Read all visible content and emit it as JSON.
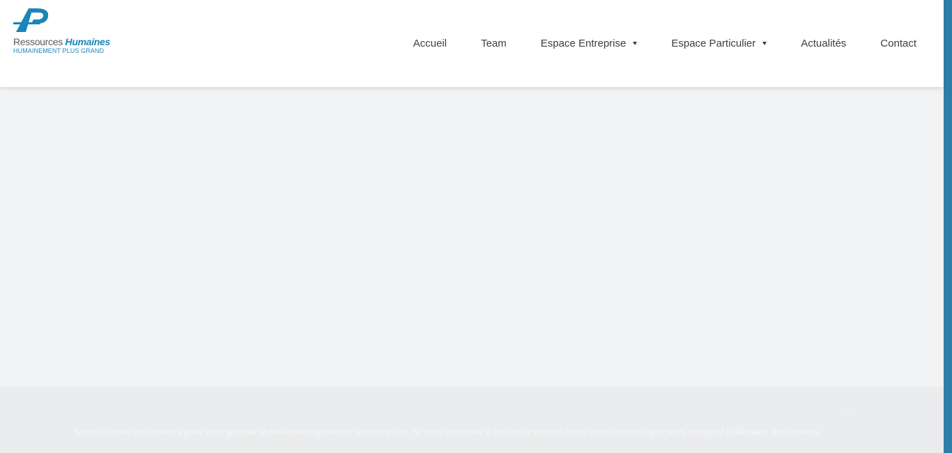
{
  "logo": {
    "brand": "Ressources",
    "brand_accent": "Humaines",
    "tagline": "HUMAINEMENT PLUS GRAND",
    "colors": {
      "primary": "#1a86b8",
      "dark": "#555a60"
    }
  },
  "nav": {
    "items": [
      {
        "label": "Accueil",
        "has_dropdown": false
      },
      {
        "label": "Team",
        "has_dropdown": false
      },
      {
        "label": "Espace Entreprise",
        "has_dropdown": true
      },
      {
        "label": "Espace Particulier",
        "has_dropdown": true
      },
      {
        "label": "Actualités",
        "has_dropdown": false
      },
      {
        "label": "Contact",
        "has_dropdown": false
      }
    ]
  },
  "cookie_bar": {
    "text": "Nous utilisons des cookies pour vous garantir la meilleure expérience sur notre site. Si vous continuez à utiliser ce dernier, nous considérerons que vous acceptez l'utilisation des cookies.",
    "close": "×"
  },
  "colors": {
    "stripe": "#2e7ea8",
    "background": "#f2f3f5"
  }
}
